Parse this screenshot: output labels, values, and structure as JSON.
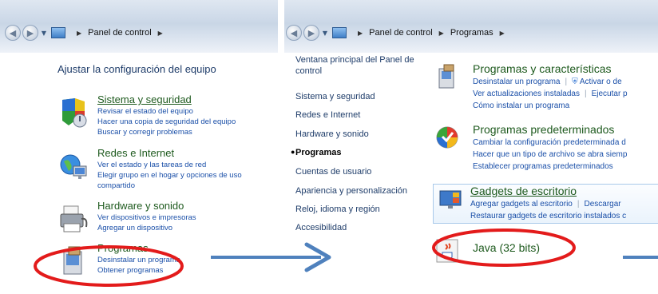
{
  "colors": {
    "link": "#1a4fa8",
    "category_title": "#1e5a1e",
    "annotation_red": "#e31b1b",
    "annotation_arrow": "#4f81bd"
  },
  "left_window": {
    "breadcrumb": [
      "Panel de control"
    ],
    "title": "Ajustar la configuración del equipo",
    "categories": [
      {
        "title": "Sistema y seguridad",
        "icon": "shield-icon",
        "links": [
          "Revisar el estado del equipo",
          "Hacer una copia de seguridad del equipo",
          "Buscar y corregir problemas"
        ]
      },
      {
        "title": "Redes e Internet",
        "icon": "network-globe-icon",
        "links": [
          "Ver el estado y las tareas de red",
          "Elegir grupo en el hogar y opciones de uso",
          "compartido"
        ]
      },
      {
        "title": "Hardware y sonido",
        "icon": "printer-icon",
        "links": [
          "Ver dispositivos e impresoras",
          "Agregar un dispositivo"
        ]
      },
      {
        "title": "Programas",
        "icon": "programs-box-icon",
        "links": [
          "Desinstalar un programa",
          "Obtener programas"
        ]
      }
    ]
  },
  "right_window": {
    "breadcrumb": [
      "Panel de control",
      "Programas"
    ],
    "sidebar": [
      "Ventana principal del Panel de",
      "control",
      "Sistema y seguridad",
      "Redes e Internet",
      "Hardware y sonido",
      "Programas",
      "Cuentas de usuario",
      "Apariencia y personalización",
      "Reloj, idioma y región",
      "Accesibilidad"
    ],
    "sections": [
      {
        "title": "Programas y características",
        "icon": "programs-features-icon",
        "lines": [
          [
            "Desinstalar un programa",
            "Activar o de"
          ],
          [
            "Ver actualizaciones instaladas",
            "Ejecutar p"
          ],
          [
            "Cómo instalar un programa"
          ]
        ]
      },
      {
        "title": "Programas predeterminados",
        "icon": "default-programs-icon",
        "lines": [
          [
            "Cambiar la configuración predeterminada d"
          ],
          [
            "Hacer que un tipo de archivo se abra siemp"
          ],
          [
            "Establecer programas predeterminados"
          ]
        ]
      },
      {
        "title": "Gadgets de escritorio",
        "icon": "desktop-gadgets-icon",
        "lines": [
          [
            "Agregar gadgets al escritorio",
            "Descargar"
          ],
          [
            "Restaurar gadgets de escritorio instalados c"
          ]
        ]
      },
      {
        "title": "Java (32 bits)",
        "icon": "java-cup-icon",
        "lines": []
      }
    ]
  }
}
